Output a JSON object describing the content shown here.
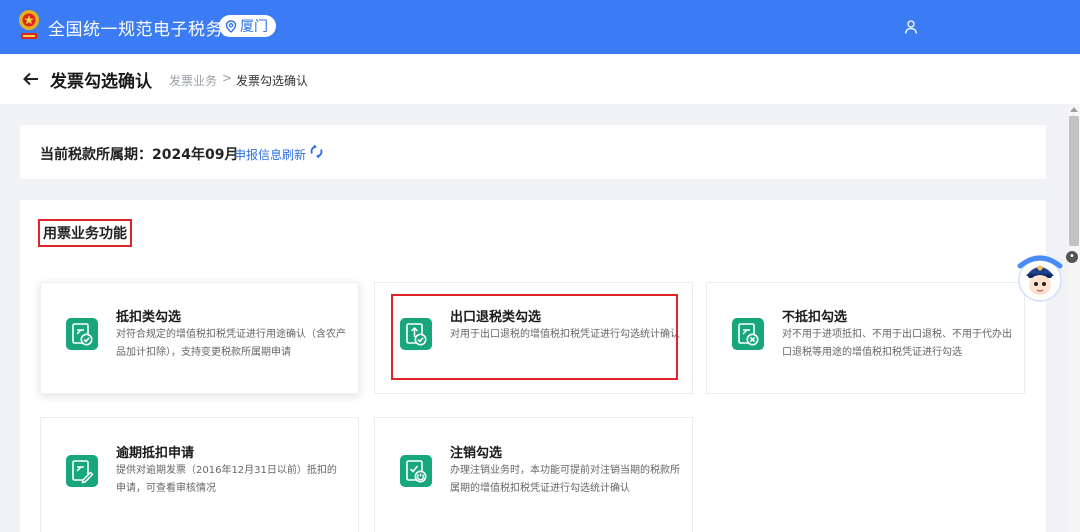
{
  "topbar": {
    "site_title": "全国统一规范电子税务局",
    "city": "厦门",
    "icons": {
      "location": "location-pin-icon",
      "user": "user-icon",
      "emblem": "national-emblem-icon"
    },
    "bg_color": "#3b7cf4"
  },
  "header": {
    "page_title": "发票勾选确认",
    "breadcrumb": [
      "发票业务",
      "发票勾选确认"
    ],
    "breadcrumb_sep": ">"
  },
  "period": {
    "label": "当前税款所属期：2024年09月",
    "refresh_label": "申报信息刷新"
  },
  "functions": {
    "section_title": "用票业务功能",
    "icon_color": "#18a77b",
    "cards": [
      {
        "title": "抵扣类勾选",
        "desc": "对符合规定的增值税扣税凭证进行用途确认（含农产品加计扣除），支持变更税款所属期申请"
      },
      {
        "title": "出口退税类勾选",
        "desc": "对用于出口退税的增值税扣税凭证进行勾选统计确认"
      },
      {
        "title": "不抵扣勾选",
        "desc": "对不用于进项抵扣、不用于出口退税、不用于代办出口退税等用途的增值税扣税凭证进行勾选"
      },
      {
        "title": "逾期抵扣申请",
        "desc": "提供对逾期发票（2016年12月31日以前）抵扣的申请，可查看审核情况"
      },
      {
        "title": "注销勾选",
        "desc": "办理注销业务时，本功能可提前对注销当期的税款所属期的增值税扣税凭证进行勾选统计确认"
      }
    ]
  }
}
